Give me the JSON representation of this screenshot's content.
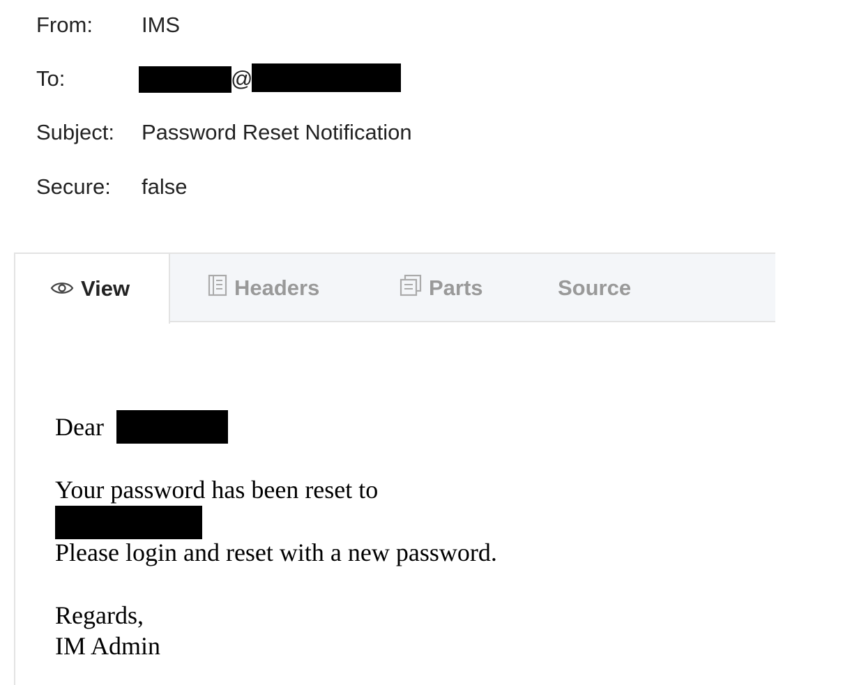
{
  "header": {
    "from_label": "From:",
    "from_value": "IMS",
    "to_label": "To:",
    "to_at": "@",
    "subject_label": "Subject:",
    "subject_value": "Password Reset Notification",
    "secure_label": "Secure:",
    "secure_value": "false"
  },
  "tabs": [
    {
      "label": "View",
      "icon": "eye-icon",
      "active": true
    },
    {
      "label": "Headers",
      "icon": "document-icon",
      "active": false
    },
    {
      "label": "Parts",
      "icon": "copy-icon",
      "active": false
    },
    {
      "label": "Source",
      "icon": "",
      "active": false
    }
  ],
  "message": {
    "greeting": "Dear",
    "line1": "Your password has been reset to",
    "line2": "Please login and reset with a new password.",
    "closing": "Regards,",
    "signature": "IM Admin"
  },
  "colors": {
    "redaction": "#000000",
    "tabbar_bg": "#f4f6f9",
    "inactive_tab_text": "#999999",
    "active_tab_text": "#222222"
  }
}
